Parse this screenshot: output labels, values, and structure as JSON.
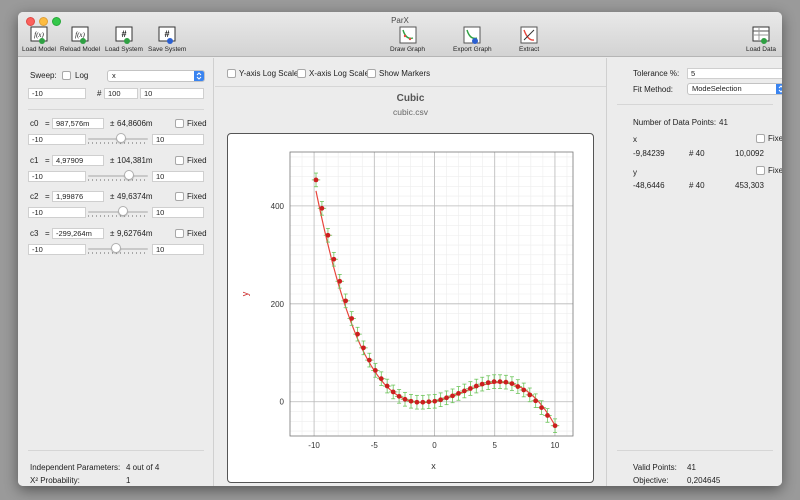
{
  "window": {
    "title": "ParX"
  },
  "toolbar": {
    "load_model": "Load Model",
    "reload_model": "Reload Model",
    "load_system": "Load System",
    "save_system": "Save System",
    "draw_graph": "Draw Graph",
    "export_graph": "Export Graph",
    "extract": "Extract",
    "load_data": "Load Data",
    "icon_text": "f(x)",
    "icon_hash": "#"
  },
  "sweep": {
    "label": "Sweep:",
    "log_label": "Log",
    "variable": "x",
    "min": "-10",
    "count_symbol": "#",
    "count": "100",
    "max": "10"
  },
  "params": [
    {
      "name": "c0",
      "eq": "=",
      "value": "987,576m",
      "pm": "±",
      "error": "64,8606m",
      "fixed": "Fixed",
      "min": "-10",
      "max": "10",
      "pos": 0.55
    },
    {
      "name": "c1",
      "eq": "=",
      "value": "4,97909",
      "pm": "±",
      "error": "104,381m",
      "fixed": "Fixed",
      "min": "-10",
      "max": "10",
      "pos": 0.72
    },
    {
      "name": "c2",
      "eq": "=",
      "value": "1,99876",
      "pm": "±",
      "error": "49,6374m",
      "fixed": "Fixed",
      "min": "-10",
      "max": "10",
      "pos": 0.6
    },
    {
      "name": "c3",
      "eq": "=",
      "value": "-299,264m",
      "pm": "±",
      "error": "9,62764m",
      "fixed": "Fixed",
      "min": "-10",
      "max": "10",
      "pos": 0.45
    }
  ],
  "stats_left": {
    "independent_label": "Independent Parameters:",
    "independent_value": "4 out of 4",
    "probability_label": "X² Probability:",
    "probability_value": "1"
  },
  "graph_options": {
    "y_log": "Y-axis Log Scale",
    "x_log": "X-axis Log Scale",
    "markers": "Show Markers"
  },
  "right": {
    "tolerance_label": "Tolerance %:",
    "tolerance_value": "5",
    "fit_label": "Fit Method:",
    "fit_value": "ModeSelection",
    "npoints_label": "Number of Data Points:",
    "npoints_value": "41",
    "x": {
      "label": "x",
      "fixed": "Fixed",
      "min": "-9,84239",
      "count": "# 40",
      "max": "10,0092"
    },
    "y": {
      "label": "y",
      "fixed": "Fixed",
      "min": "-48,6446",
      "count": "# 40",
      "max": "453,303"
    },
    "valid_label": "Valid Points:",
    "valid_value": "41",
    "objective_label": "Objective:",
    "objective_value": "0,204645"
  },
  "colors": {
    "fit_curve": "#e8453c",
    "points": "#cc1f1f",
    "error_bars": "#6dc55b",
    "y_label": "#cc2a2a",
    "accent": "#3a84f0"
  },
  "chart_data": {
    "type": "scatter",
    "title": "Cubic",
    "subtitle": "cubic.csv",
    "xlabel": "x",
    "ylabel": "y",
    "xlim": [
      -12,
      11.5
    ],
    "ylim": [
      -70,
      510
    ],
    "xticks": [
      -10,
      -5,
      0,
      5,
      10
    ],
    "yticks": [
      0,
      200,
      400
    ],
    "grid": true,
    "fit": {
      "c0": 0.987576,
      "c1": 4.97909,
      "c2": 1.99876,
      "c3": -0.299264
    },
    "x": [
      -9.84,
      -9.35,
      -8.85,
      -8.36,
      -7.87,
      -7.38,
      -6.88,
      -6.39,
      -5.9,
      -5.41,
      -4.91,
      -4.42,
      -3.93,
      -3.43,
      -2.94,
      -2.45,
      -1.95,
      -1.46,
      -0.97,
      -0.47,
      0.02,
      0.51,
      1.0,
      1.5,
      1.99,
      2.48,
      2.98,
      3.47,
      3.96,
      4.46,
      4.95,
      5.44,
      5.93,
      6.43,
      6.92,
      7.41,
      7.91,
      8.4,
      8.89,
      9.38,
      10.01
    ],
    "y": [
      453,
      395,
      340,
      291,
      246,
      206,
      170,
      138,
      110,
      85,
      64,
      47,
      32,
      20,
      11,
      5,
      1,
      -1,
      -1,
      0,
      1,
      4,
      8,
      12,
      17,
      22,
      27,
      32,
      36,
      39,
      41,
      41,
      40,
      37,
      31,
      24,
      14,
      2,
      -12,
      -28,
      -49
    ]
  }
}
